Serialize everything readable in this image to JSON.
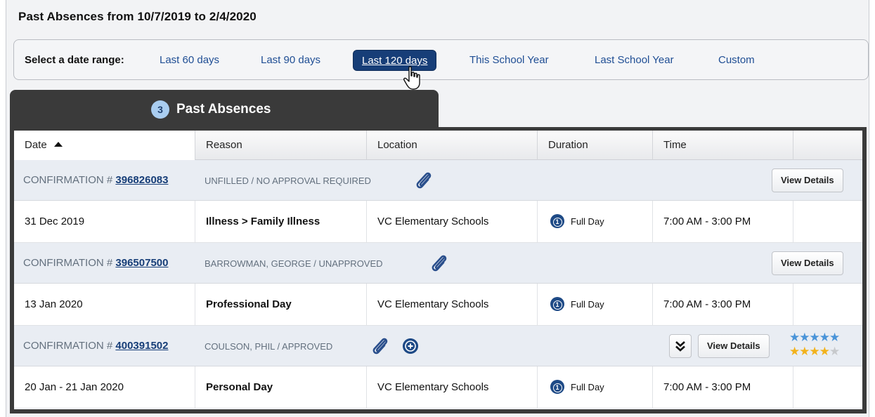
{
  "page": {
    "title": "Past Absences from 10/7/2019  to  2/4/2020"
  },
  "date_range": {
    "label": "Select a date range:",
    "options": [
      {
        "label": "Last 60 days",
        "active": false
      },
      {
        "label": "Last 90 days",
        "active": false
      },
      {
        "label": "Last 120 days",
        "active": true
      },
      {
        "label": "This School Year",
        "active": false
      },
      {
        "label": "Last School Year",
        "active": false
      },
      {
        "label": "Custom",
        "active": false
      }
    ]
  },
  "tab": {
    "count": "3",
    "label": "Past Absences"
  },
  "table": {
    "headers": [
      "Date",
      "Reason",
      "Location",
      "Duration",
      "Time",
      ""
    ],
    "sorted_column": "Date",
    "rows": [
      {
        "confirmation_prefix": "CONFIRMATION # ",
        "confirmation_number": "396826083",
        "status": "UNFILLED / NO APPROVAL REQUIRED",
        "details_label": "View Details",
        "date": "31 Dec 2019",
        "reason": "Illness > Family Illness",
        "location": "VC Elementary Schools",
        "duration": "Full Day",
        "duration_icon_number": "1",
        "time": "7:00 AM - 3:00 PM"
      },
      {
        "confirmation_prefix": "CONFIRMATION # ",
        "confirmation_number": "396507500",
        "status": "BARROWMAN, GEORGE / UNAPPROVED",
        "details_label": "View Details",
        "date": "13 Jan 2020",
        "reason": "Professional Day",
        "location": "VC Elementary Schools",
        "duration": "Full Day",
        "duration_icon_number": "1",
        "time": "7:00 AM - 3:00 PM"
      },
      {
        "confirmation_prefix": "CONFIRMATION # ",
        "confirmation_number": "400391502",
        "status": "COULSON, PHIL / APPROVED",
        "details_label": "View Details",
        "rating_blue": 5,
        "rating_gold": 4,
        "rating_max": 5,
        "date": "20 Jan - 21 Jan 2020",
        "reason": "Personal Day",
        "location": "VC Elementary Schools",
        "duration": "Full Day",
        "duration_icon_number": "1",
        "time": "7:00 AM - 3:00 PM"
      }
    ]
  },
  "colors": {
    "accent": "#173e78",
    "header_dark": "#3a3a3a",
    "badge": "#a9cdf0",
    "star_blue": "#4a94d8",
    "star_gold": "#f2b21b"
  }
}
